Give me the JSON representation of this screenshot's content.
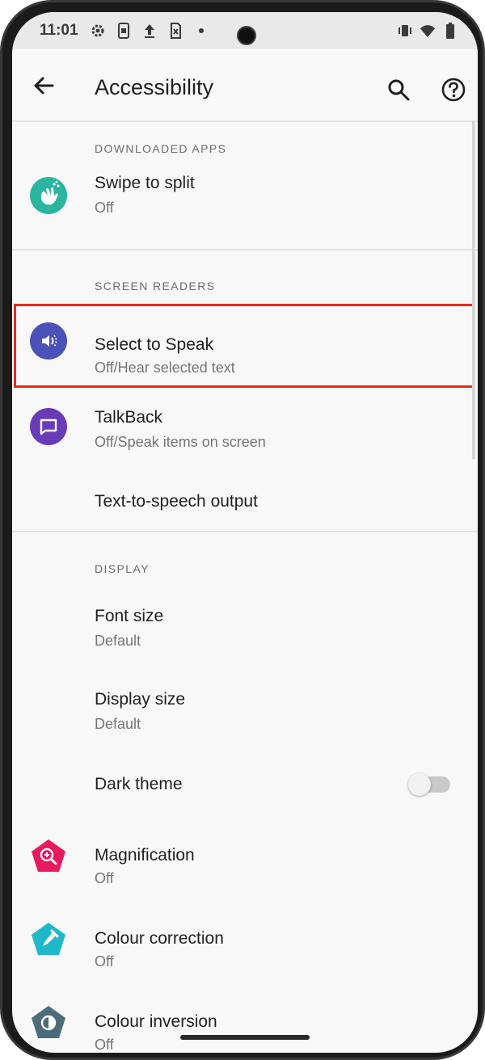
{
  "status_bar": {
    "time": "11:01",
    "icons": [
      "settings-icon",
      "screenshot-icon",
      "upload-icon",
      "sim-icon",
      "dot-icon",
      "vibrate-icon",
      "wifi-icon",
      "battery-icon"
    ]
  },
  "app_bar": {
    "title": "Accessibility",
    "icons": [
      "back-arrow-icon",
      "search-icon",
      "help-icon"
    ]
  },
  "sections": {
    "downloaded_apps": {
      "header": "DOWNLOADED APPS",
      "items": [
        {
          "title": "Swipe to split",
          "subtitle": "Off",
          "icon": "swipe-hand-icon",
          "color": "#2bb5a0"
        }
      ]
    },
    "screen_readers": {
      "header": "SCREEN READERS",
      "items": [
        {
          "title": "Select to Speak",
          "subtitle": "Off/Hear selected text",
          "icon": "speaker-icon",
          "color": "#4a52b8"
        },
        {
          "title": "TalkBack",
          "subtitle": "Off/Speak items on screen",
          "icon": "chat-bubble-icon",
          "color": "#6a3bb8"
        },
        {
          "title": "Text-to-speech output"
        }
      ]
    },
    "display": {
      "header": "DISPLAY",
      "items": [
        {
          "title": "Font size",
          "subtitle": "Default"
        },
        {
          "title": "Display size",
          "subtitle": "Default"
        },
        {
          "title": "Dark theme",
          "toggle": "off"
        },
        {
          "title": "Magnification",
          "subtitle": "Off",
          "icon": "magnifier-icon",
          "color": "#e8195f"
        },
        {
          "title": "Colour correction",
          "subtitle": "Off",
          "icon": "eyedropper-icon",
          "color": "#1fb8c9"
        },
        {
          "title": "Colour inversion",
          "subtitle": "Off",
          "icon": "inversion-icon",
          "color": "#4b6c7a"
        }
      ]
    }
  },
  "highlight_color": "#e8291c"
}
